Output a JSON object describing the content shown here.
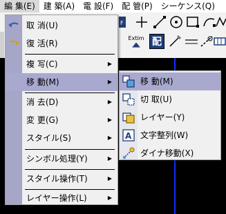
{
  "menubar": {
    "items": [
      {
        "label": "編 集(E)"
      },
      {
        "label": "建 築(A)"
      },
      {
        "label": "電 設(F)"
      },
      {
        "label": "配 管(P)"
      },
      {
        "label": "シーケンス(Q)"
      }
    ]
  },
  "toolbar": {
    "extim_label": "Extim",
    "haichi_label": "配"
  },
  "edit_menu": {
    "items": [
      {
        "label": "取 消(U)",
        "icon": "undo-icon",
        "has_submenu": false
      },
      {
        "label": "復 活(R)",
        "icon": "redo-icon",
        "has_submenu": false
      },
      {
        "label": "複 写(C)",
        "icon": "",
        "has_submenu": true
      },
      {
        "label": "移 動(M)",
        "icon": "",
        "has_submenu": true
      },
      {
        "label": "消 去(D)",
        "icon": "",
        "has_submenu": true
      },
      {
        "label": "変 更(G)",
        "icon": "",
        "has_submenu": true
      },
      {
        "label": "スタイル(S)",
        "icon": "",
        "has_submenu": true
      },
      {
        "label": "シンボル処理(Y)",
        "icon": "",
        "has_submenu": true
      },
      {
        "label": "スタイル操作(T)",
        "icon": "",
        "has_submenu": true
      },
      {
        "label": "レイヤー操作(L)",
        "icon": "",
        "has_submenu": true
      }
    ],
    "arrow_glyph": "▶"
  },
  "move_submenu": {
    "items": [
      {
        "label": "移 動(M)",
        "icon": "move-icon"
      },
      {
        "label": "切 取(U)",
        "icon": "cut-icon"
      },
      {
        "label": "レイヤー(Y)",
        "icon": "layer-icon"
      },
      {
        "label": "文字整列(W)",
        "icon": "text-align-icon"
      },
      {
        "label": "ダイナ移動(X)",
        "icon": "dyna-move-icon"
      }
    ]
  },
  "colors": {
    "highlight": "#a9a9d0",
    "gutter": "#a6a6c8",
    "menu_bg": "#f0f0f0",
    "canvas_bg": "#000000",
    "canvas_line": "#1030ff",
    "toolbar_dark": "#1f3f7a"
  }
}
